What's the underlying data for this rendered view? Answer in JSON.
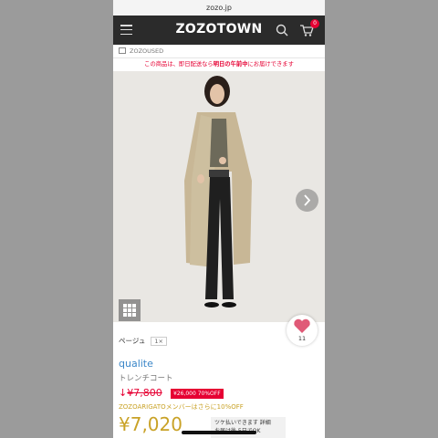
{
  "browser": {
    "url": "zozo.jp"
  },
  "header": {
    "logo": "ZOZOTOWN",
    "cart_count": "0"
  },
  "subbar": {
    "label": "ZOZOUSED"
  },
  "notice": {
    "prefix": "この商品は、即日配送なら",
    "bold": "明日の午前中",
    "suffix": "にお届けできます"
  },
  "gallery": {
    "favorite_count": "11"
  },
  "pager": {
    "label": "ページュ",
    "page": "1×"
  },
  "product": {
    "brand": "qualite",
    "type": "トレンチコート",
    "old_price_arrow": "↓",
    "old_price": "¥7,800",
    "off_badge": "¥26,000 70%OFF",
    "member_note": "ZOZOARIGATOメンバーはさらに10%OFF",
    "price": "¥7,020"
  },
  "pay_later": {
    "line1": "ツケ払いできます 詳細",
    "line2": "お届け後 5日でOK"
  },
  "colors": {
    "accent_red": "#e60033",
    "price_gold": "#c9a227",
    "brand_blue": "#3a86c8",
    "header_bg": "#2b2b2b"
  }
}
